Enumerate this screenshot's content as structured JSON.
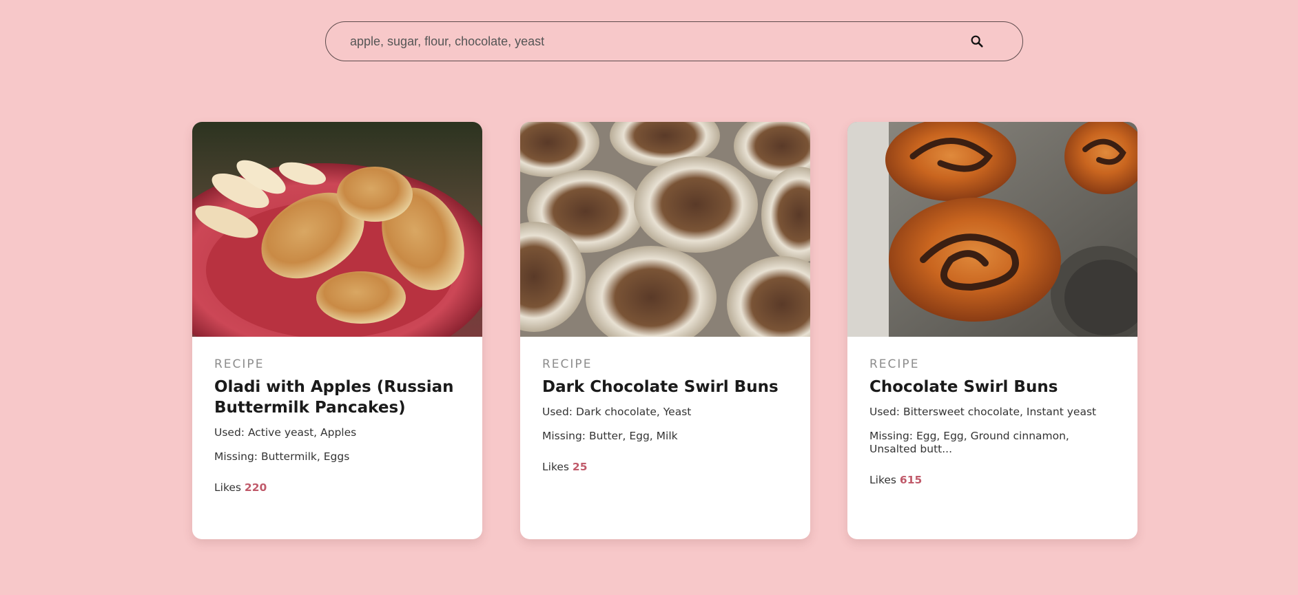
{
  "search": {
    "placeholder": "apple, sugar, flour, chocolate, yeast",
    "icon": "search-icon"
  },
  "colors": {
    "background": "#f7c8c9",
    "card": "#ffffff",
    "accent": "#c05a6a"
  },
  "recipes": [
    {
      "type": "RECIPE",
      "title": "Oladi with Apples (Russian Buttermilk Pancakes)",
      "used": "Used: Active yeast, Apples",
      "missing": "Missing: Buttermilk, Eggs",
      "likes_label": "Likes",
      "likes": "220"
    },
    {
      "type": "RECIPE",
      "title": "Dark Chocolate Swirl Buns",
      "used": "Used: Dark chocolate, Yeast",
      "missing": "Missing: Butter, Egg, Milk",
      "likes_label": "Likes",
      "likes": "25"
    },
    {
      "type": "RECIPE",
      "title": "Chocolate Swirl Buns",
      "used": "Used: Bittersweet chocolate, Instant yeast",
      "missing": "Missing: Egg, Egg, Ground cinnamon, Unsalted butt...",
      "likes_label": "Likes",
      "likes": "615"
    }
  ]
}
